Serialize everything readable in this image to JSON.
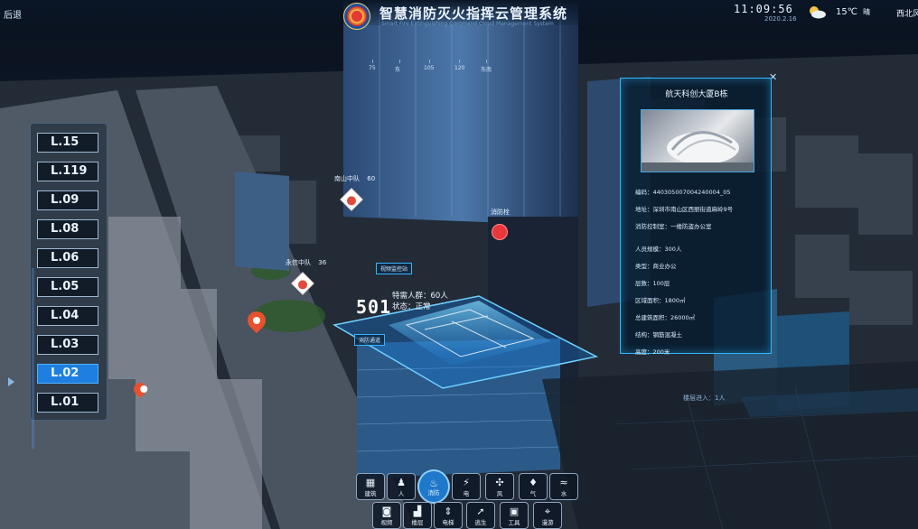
{
  "header": {
    "back_label": "后退",
    "app_title": "智慧消防灭火指挥云管理系统",
    "app_subtitle": "Smart Fire Extinguishing Command Cloud Management System",
    "time": "11:09:56",
    "date": "2020.2.16",
    "temperature": "15℃",
    "weather": "晴",
    "wind": "西北风",
    "weather_icon": "partly-cloudy-icon"
  },
  "compass": {
    "ticks": [
      "75",
      "东",
      "105",
      "120",
      "东南"
    ]
  },
  "floors": {
    "items": [
      "L.15",
      "L.119",
      "L.09",
      "L.08",
      "L.06",
      "L.05",
      "L.04",
      "L.03",
      "L.02",
      "L.01"
    ],
    "active": "L.02"
  },
  "info_card": {
    "title": "航天科创大厦B栋",
    "rows": [
      "编码：440305007004240004_05",
      "地址：深圳市南山区西丽街道麻岭9号",
      "消防控制室：一楼防盗办公室",
      "人员规模：300人",
      "类型：商业办公",
      "层数：100层",
      "区域面积：1800㎡",
      "总建筑面积：26000㎡",
      "结构：钢筋混凝土",
      "高度：200米"
    ]
  },
  "map_labels": {
    "station_nanshan": "南山中队",
    "station_nanshan_count": "60",
    "station_yongan": "永信中队",
    "station_yongan_count": "36",
    "hydrant": "消防栓",
    "monitor_station": "视频监控站",
    "occupancy_number": "501",
    "occupancy_people": "特需人群：60人",
    "occupancy_status": "状态：正常",
    "fire_exit": "消防通道",
    "people_count": "楼层进入：1人"
  },
  "toolbar": {
    "row1": [
      {
        "label": "建筑",
        "icon": "building-icon",
        "glyph": "▦"
      },
      {
        "label": "人",
        "icon": "person-icon",
        "glyph": "♟"
      },
      {
        "label": "消防",
        "icon": "fire-station-icon",
        "glyph": "♨"
      },
      {
        "label": "电",
        "icon": "electric-icon",
        "glyph": "⚡"
      },
      {
        "label": "风",
        "icon": "fan-icon",
        "glyph": "✣"
      },
      {
        "label": "气",
        "icon": "gas-flame-icon",
        "glyph": "♦"
      },
      {
        "label": "水",
        "icon": "water-icon",
        "glyph": "≈"
      }
    ],
    "row2": [
      {
        "label": "视频",
        "icon": "camera-icon",
        "glyph": "◙"
      },
      {
        "label": "楼层",
        "icon": "stairs-icon",
        "glyph": "▟"
      },
      {
        "label": "电梯",
        "icon": "elevator-icon",
        "glyph": "⇕"
      },
      {
        "label": "逃生",
        "icon": "exit-run-icon",
        "glyph": "➚"
      },
      {
        "label": "工具",
        "icon": "toolbox-icon",
        "glyph": "▣"
      },
      {
        "label": "漫游",
        "icon": "roam-pin-icon",
        "glyph": "⌖"
      }
    ],
    "active": "消防"
  },
  "colors": {
    "accent": "#2fb7ff",
    "active_floor": "#1e7fe0",
    "alert_red": "#e8383b"
  }
}
